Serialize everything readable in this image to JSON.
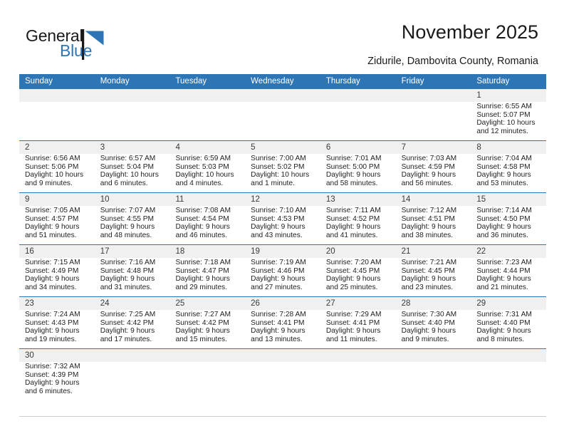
{
  "brand": {
    "name_top": "General",
    "name_bottom": "Blue",
    "accent_color": "#2E75B6"
  },
  "header": {
    "title": "November 2025",
    "subtitle": "Zidurile, Dambovita County, Romania"
  },
  "calendar": {
    "weekday_headers": [
      "Sunday",
      "Monday",
      "Tuesday",
      "Wednesday",
      "Thursday",
      "Friday",
      "Saturday"
    ],
    "header_bg": "#2E75B6",
    "date_strip_bg": "#F0F0F0",
    "row_rule_color": "#2E75B6",
    "weeks": [
      [
        {
          "empty": true
        },
        {
          "empty": true
        },
        {
          "empty": true
        },
        {
          "empty": true
        },
        {
          "empty": true
        },
        {
          "empty": true
        },
        {
          "day": "1",
          "sunrise": "Sunrise: 6:55 AM",
          "sunset": "Sunset: 5:07 PM",
          "daylight1": "Daylight: 10 hours",
          "daylight2": "and 12 minutes."
        }
      ],
      [
        {
          "day": "2",
          "sunrise": "Sunrise: 6:56 AM",
          "sunset": "Sunset: 5:06 PM",
          "daylight1": "Daylight: 10 hours",
          "daylight2": "and 9 minutes."
        },
        {
          "day": "3",
          "sunrise": "Sunrise: 6:57 AM",
          "sunset": "Sunset: 5:04 PM",
          "daylight1": "Daylight: 10 hours",
          "daylight2": "and 6 minutes."
        },
        {
          "day": "4",
          "sunrise": "Sunrise: 6:59 AM",
          "sunset": "Sunset: 5:03 PM",
          "daylight1": "Daylight: 10 hours",
          "daylight2": "and 4 minutes."
        },
        {
          "day": "5",
          "sunrise": "Sunrise: 7:00 AM",
          "sunset": "Sunset: 5:02 PM",
          "daylight1": "Daylight: 10 hours",
          "daylight2": "and 1 minute."
        },
        {
          "day": "6",
          "sunrise": "Sunrise: 7:01 AM",
          "sunset": "Sunset: 5:00 PM",
          "daylight1": "Daylight: 9 hours",
          "daylight2": "and 58 minutes."
        },
        {
          "day": "7",
          "sunrise": "Sunrise: 7:03 AM",
          "sunset": "Sunset: 4:59 PM",
          "daylight1": "Daylight: 9 hours",
          "daylight2": "and 56 minutes."
        },
        {
          "day": "8",
          "sunrise": "Sunrise: 7:04 AM",
          "sunset": "Sunset: 4:58 PM",
          "daylight1": "Daylight: 9 hours",
          "daylight2": "and 53 minutes."
        }
      ],
      [
        {
          "day": "9",
          "sunrise": "Sunrise: 7:05 AM",
          "sunset": "Sunset: 4:57 PM",
          "daylight1": "Daylight: 9 hours",
          "daylight2": "and 51 minutes."
        },
        {
          "day": "10",
          "sunrise": "Sunrise: 7:07 AM",
          "sunset": "Sunset: 4:55 PM",
          "daylight1": "Daylight: 9 hours",
          "daylight2": "and 48 minutes."
        },
        {
          "day": "11",
          "sunrise": "Sunrise: 7:08 AM",
          "sunset": "Sunset: 4:54 PM",
          "daylight1": "Daylight: 9 hours",
          "daylight2": "and 46 minutes."
        },
        {
          "day": "12",
          "sunrise": "Sunrise: 7:10 AM",
          "sunset": "Sunset: 4:53 PM",
          "daylight1": "Daylight: 9 hours",
          "daylight2": "and 43 minutes."
        },
        {
          "day": "13",
          "sunrise": "Sunrise: 7:11 AM",
          "sunset": "Sunset: 4:52 PM",
          "daylight1": "Daylight: 9 hours",
          "daylight2": "and 41 minutes."
        },
        {
          "day": "14",
          "sunrise": "Sunrise: 7:12 AM",
          "sunset": "Sunset: 4:51 PM",
          "daylight1": "Daylight: 9 hours",
          "daylight2": "and 38 minutes."
        },
        {
          "day": "15",
          "sunrise": "Sunrise: 7:14 AM",
          "sunset": "Sunset: 4:50 PM",
          "daylight1": "Daylight: 9 hours",
          "daylight2": "and 36 minutes."
        }
      ],
      [
        {
          "day": "16",
          "sunrise": "Sunrise: 7:15 AM",
          "sunset": "Sunset: 4:49 PM",
          "daylight1": "Daylight: 9 hours",
          "daylight2": "and 34 minutes."
        },
        {
          "day": "17",
          "sunrise": "Sunrise: 7:16 AM",
          "sunset": "Sunset: 4:48 PM",
          "daylight1": "Daylight: 9 hours",
          "daylight2": "and 31 minutes."
        },
        {
          "day": "18",
          "sunrise": "Sunrise: 7:18 AM",
          "sunset": "Sunset: 4:47 PM",
          "daylight1": "Daylight: 9 hours",
          "daylight2": "and 29 minutes."
        },
        {
          "day": "19",
          "sunrise": "Sunrise: 7:19 AM",
          "sunset": "Sunset: 4:46 PM",
          "daylight1": "Daylight: 9 hours",
          "daylight2": "and 27 minutes."
        },
        {
          "day": "20",
          "sunrise": "Sunrise: 7:20 AM",
          "sunset": "Sunset: 4:45 PM",
          "daylight1": "Daylight: 9 hours",
          "daylight2": "and 25 minutes."
        },
        {
          "day": "21",
          "sunrise": "Sunrise: 7:21 AM",
          "sunset": "Sunset: 4:45 PM",
          "daylight1": "Daylight: 9 hours",
          "daylight2": "and 23 minutes."
        },
        {
          "day": "22",
          "sunrise": "Sunrise: 7:23 AM",
          "sunset": "Sunset: 4:44 PM",
          "daylight1": "Daylight: 9 hours",
          "daylight2": "and 21 minutes."
        }
      ],
      [
        {
          "day": "23",
          "sunrise": "Sunrise: 7:24 AM",
          "sunset": "Sunset: 4:43 PM",
          "daylight1": "Daylight: 9 hours",
          "daylight2": "and 19 minutes."
        },
        {
          "day": "24",
          "sunrise": "Sunrise: 7:25 AM",
          "sunset": "Sunset: 4:42 PM",
          "daylight1": "Daylight: 9 hours",
          "daylight2": "and 17 minutes."
        },
        {
          "day": "25",
          "sunrise": "Sunrise: 7:27 AM",
          "sunset": "Sunset: 4:42 PM",
          "daylight1": "Daylight: 9 hours",
          "daylight2": "and 15 minutes."
        },
        {
          "day": "26",
          "sunrise": "Sunrise: 7:28 AM",
          "sunset": "Sunset: 4:41 PM",
          "daylight1": "Daylight: 9 hours",
          "daylight2": "and 13 minutes."
        },
        {
          "day": "27",
          "sunrise": "Sunrise: 7:29 AM",
          "sunset": "Sunset: 4:41 PM",
          "daylight1": "Daylight: 9 hours",
          "daylight2": "and 11 minutes."
        },
        {
          "day": "28",
          "sunrise": "Sunrise: 7:30 AM",
          "sunset": "Sunset: 4:40 PM",
          "daylight1": "Daylight: 9 hours",
          "daylight2": "and 9 minutes."
        },
        {
          "day": "29",
          "sunrise": "Sunrise: 7:31 AM",
          "sunset": "Sunset: 4:40 PM",
          "daylight1": "Daylight: 9 hours",
          "daylight2": "and 8 minutes."
        }
      ],
      [
        {
          "day": "30",
          "sunrise": "Sunrise: 7:32 AM",
          "sunset": "Sunset: 4:39 PM",
          "daylight1": "Daylight: 9 hours",
          "daylight2": "and 6 minutes."
        },
        {
          "empty": true
        },
        {
          "empty": true
        },
        {
          "empty": true
        },
        {
          "empty": true
        },
        {
          "empty": true
        },
        {
          "empty": true
        }
      ]
    ]
  }
}
